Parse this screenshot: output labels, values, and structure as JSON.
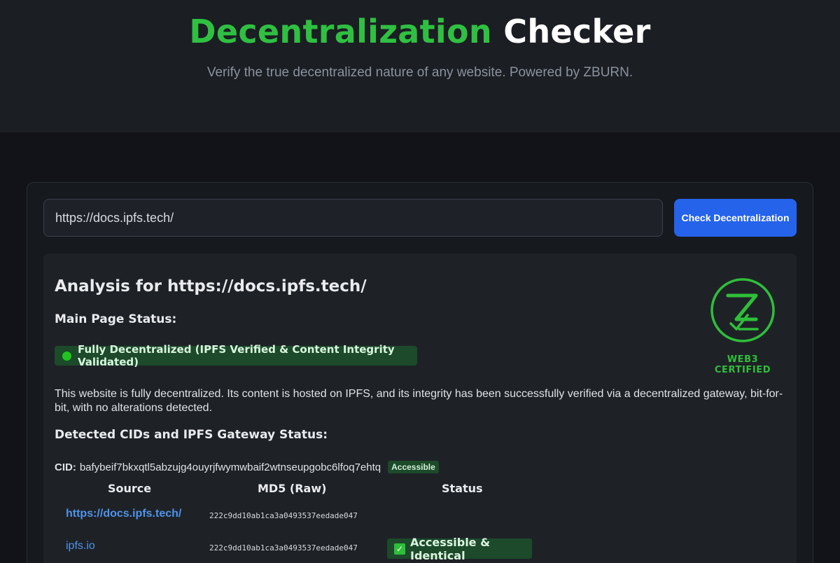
{
  "header": {
    "title_green": "Decentralization",
    "title_white": "Checker",
    "subtitle": "Verify the true decentralized nature of any website. Powered by ZBURN."
  },
  "form": {
    "url_value": "https://docs.ipfs.tech/",
    "check_button_label": "Check Decentralization"
  },
  "results": {
    "analysis_title": "Analysis for https://docs.ipfs.tech/",
    "main_status_heading": "Main Page Status:",
    "main_status_badge": "Fully Decentralized (IPFS Verified & Content Integrity Validated)",
    "description": "This website is fully decentralized. Its content is hosted on IPFS, and its integrity has been successfully verified via a decentralized gateway, bit-for-bit, with no alterations detected.",
    "cids_heading": "Detected CIDs and IPFS Gateway Status:",
    "cid_label": "CID:",
    "cid_value": "bafybeif7bkxqtl5abzujg4ouyrjfwymwbaif2wtnseupgobc6lfoq7ehtq",
    "cid_status": "Accessible",
    "logo_caption": "WEB3 CERTIFIED"
  },
  "table": {
    "columns": [
      "Source",
      "MD5 (Raw)",
      "Status"
    ],
    "rows": [
      {
        "source": "https://docs.ipfs.tech/",
        "md5": "222c9dd10ab1ca3a0493537eedade047",
        "status": ""
      },
      {
        "source": "ipfs.io",
        "md5": "222c9dd10ab1ca3a0493537eedade047",
        "status": "Accessible & Identical"
      }
    ]
  },
  "colors": {
    "accent_green": "#2fc042",
    "button_blue": "#2563eb",
    "link_blue": "#4f93e8",
    "success_bg": "#1c4a2a"
  }
}
